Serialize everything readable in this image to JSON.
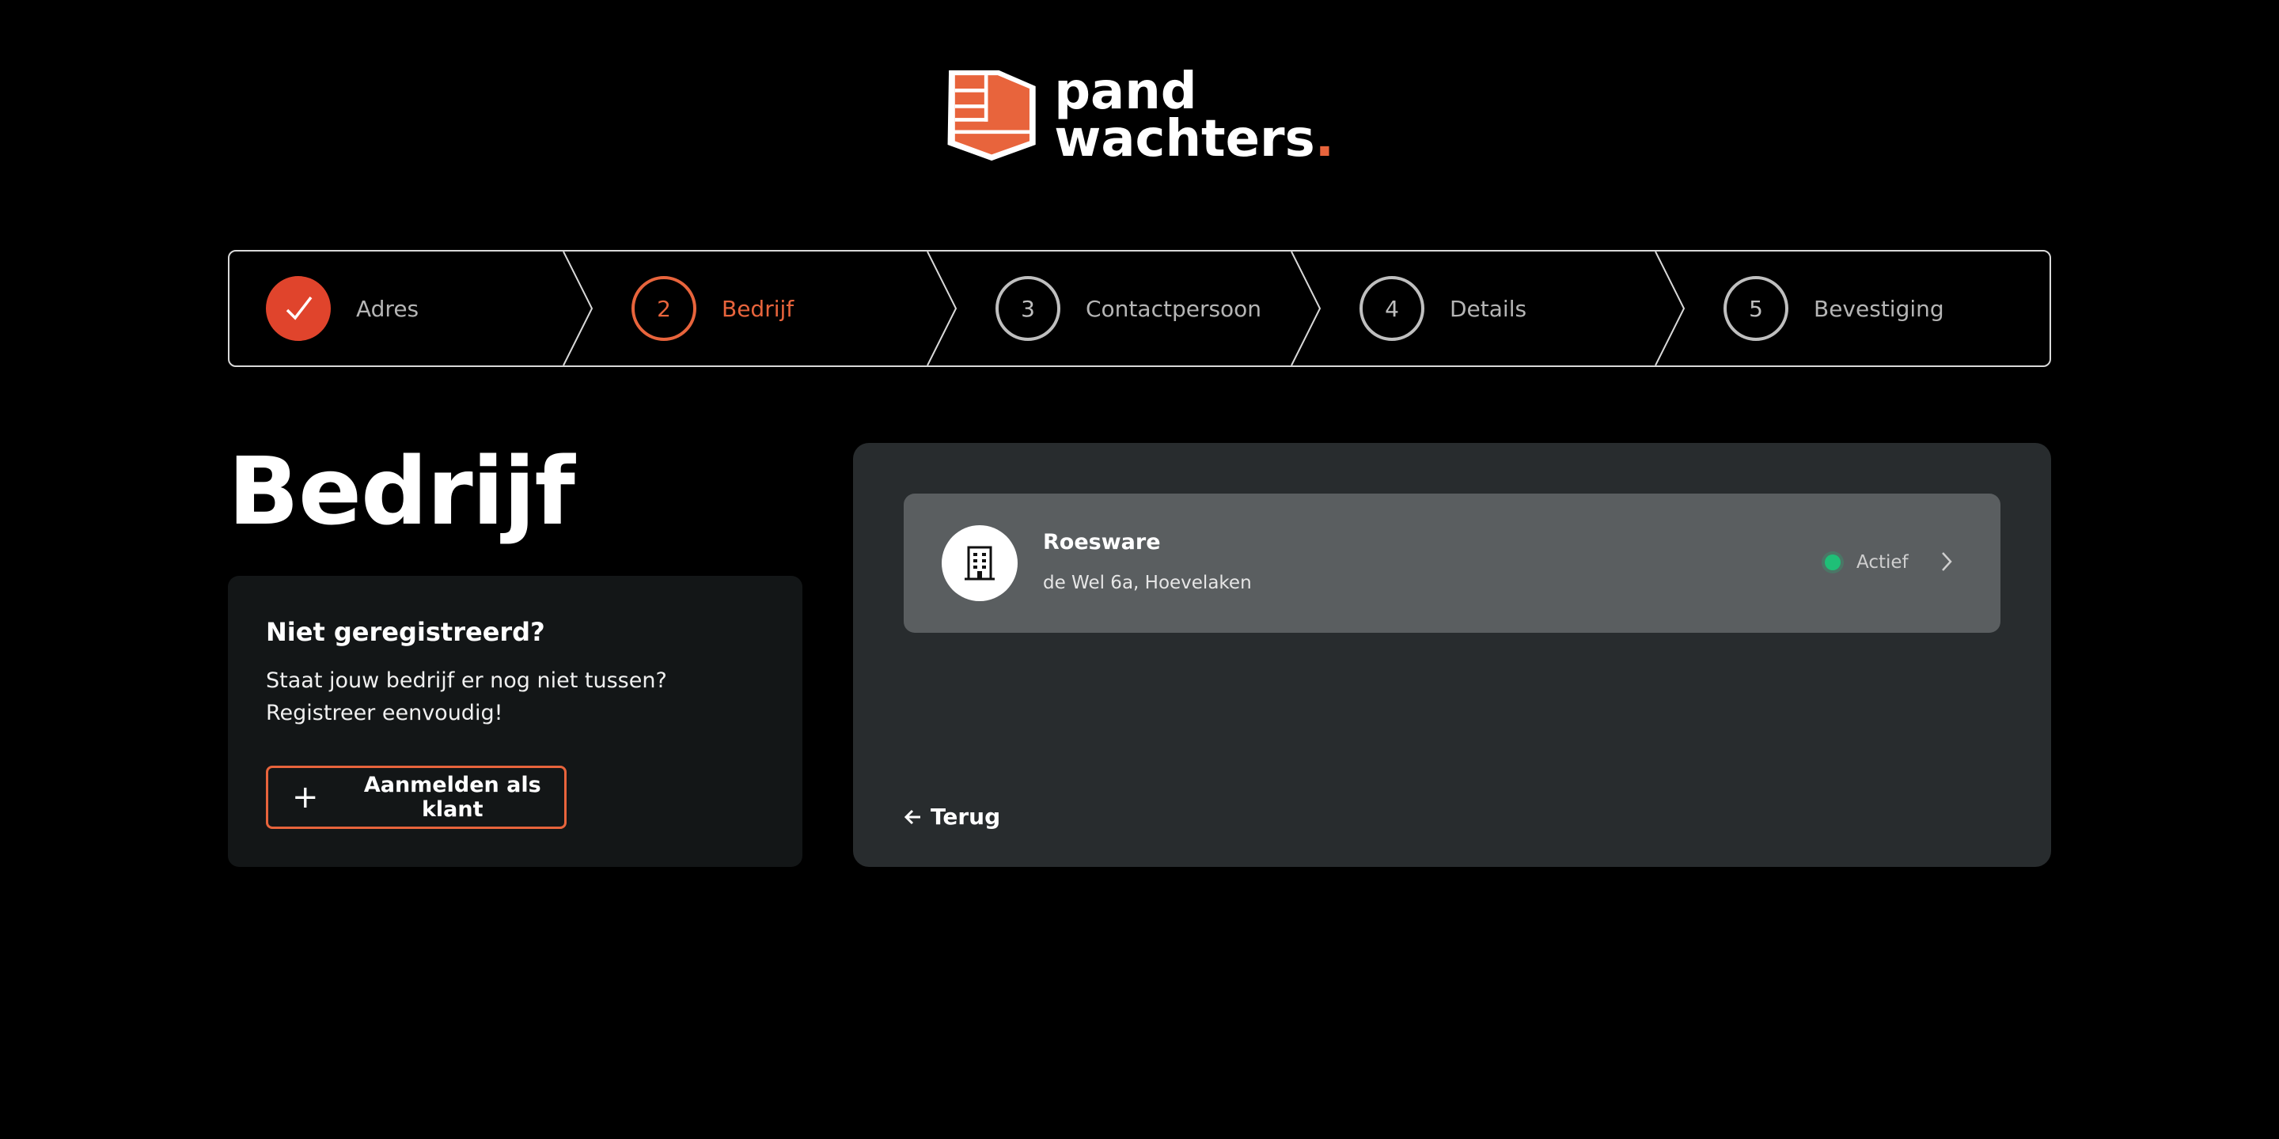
{
  "brand": {
    "line1": "pand",
    "line2": "wachters",
    "dot": ".",
    "accent_color": "#e8643c"
  },
  "stepper": {
    "steps": [
      {
        "number": "1",
        "label": "Adres",
        "state": "done",
        "icon": "checkmark-icon"
      },
      {
        "number": "2",
        "label": "Bedrijf",
        "state": "active"
      },
      {
        "number": "3",
        "label": "Contactpersoon",
        "state": "upcoming"
      },
      {
        "number": "4",
        "label": "Details",
        "state": "upcoming"
      },
      {
        "number": "5",
        "label": "Bevestiging",
        "state": "upcoming"
      }
    ]
  },
  "page": {
    "title": "Bedrijf"
  },
  "register_card": {
    "title": "Niet geregistreerd?",
    "text": "Staat jouw bedrijf er nog niet tussen? Registreer eenvoudig!",
    "button_label": "Aanmelden als klant",
    "button_icon": "plus-icon"
  },
  "companies": [
    {
      "name": "Roesware",
      "address": "de Wel 6a, Hoevelaken",
      "status": "Actief",
      "status_color": "#1fbf77",
      "icon": "building-icon"
    }
  ],
  "navigation": {
    "back_label": "Terug",
    "back_icon": "arrow-left-icon"
  }
}
